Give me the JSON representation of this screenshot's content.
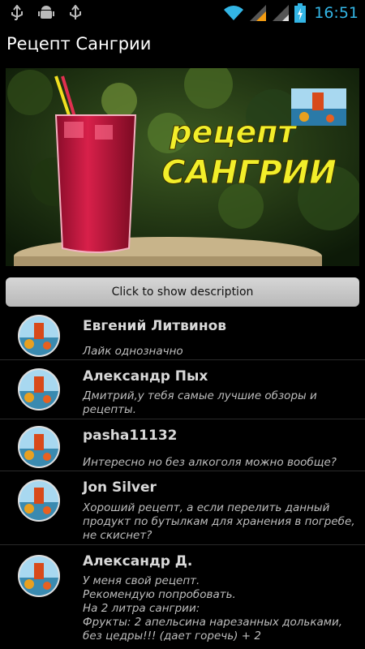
{
  "status_bar": {
    "time": "16:51",
    "icons": [
      "usb-icon",
      "android-debug-icon",
      "usb-icon",
      "wifi-icon",
      "signal-icon",
      "signal-icon",
      "battery-charging-icon"
    ]
  },
  "action_bar": {
    "title": "Рецепт Сангрии"
  },
  "video": {
    "overlay_line1": "рецепт",
    "overlay_line2": "САНГРИИ"
  },
  "description_button": {
    "label": "Click to show description"
  },
  "comments": [
    {
      "author": "Евгений Литвинов",
      "text": "Лайк однозначно"
    },
    {
      "author": "Александр Пых",
      "text": "Дмитрий,у тебя самые лучшие обзоры и рецепты."
    },
    {
      "author": "pasha11132",
      "text": "Интересно но без алкоголя можно вообще?"
    },
    {
      "author": "Jon Silver",
      "text": "Хороший рецепт, а если перелить данный продукт по бутылкам для хранения в погребе, не скиснет?"
    },
    {
      "author": "Александр Д.",
      "text": "У меня свой рецепт.\nРекомендую попробовать.\nНа 2 литра сангрии:\nФрукты: 2 апельсина нарезанных дольками, без цедры!!! (дает горечь) + 2"
    }
  ],
  "colors": {
    "time": "#33b5e5",
    "overlay_text": "#f2ee2a"
  }
}
